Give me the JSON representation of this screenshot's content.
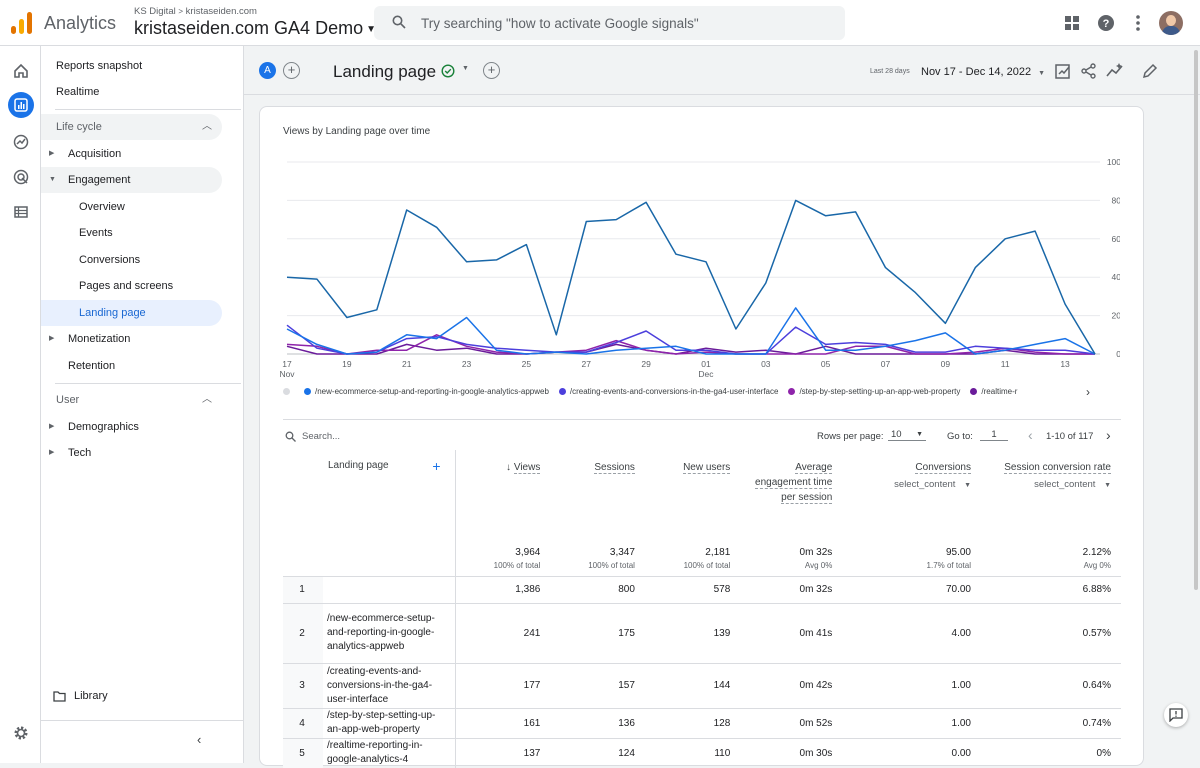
{
  "topbar": {
    "app_name": "Analytics",
    "account_sub_org": "KS Digital",
    "account_sub_prop": "kristaseiden.com",
    "property_name": "kristaseiden.com GA4 Demo",
    "search_placeholder": "Try searching \"how to activate Google signals\""
  },
  "sidebar": {
    "reports_snapshot": "Reports snapshot",
    "realtime": "Realtime",
    "lifecycle_label": "Life cycle",
    "acquisition": "Acquisition",
    "engagement": "Engagement",
    "engagement_items": [
      "Overview",
      "Events",
      "Conversions",
      "Pages and screens",
      "Landing page"
    ],
    "monetization": "Monetization",
    "retention": "Retention",
    "user_label": "User",
    "demographics": "Demographics",
    "tech": "Tech",
    "library": "Library"
  },
  "header": {
    "comparison_badge": "A",
    "page_title": "Landing page",
    "date_label": "Last 28 days",
    "date_range": "Nov 17 - Dec 14, 2022"
  },
  "chart_card": {
    "title": "Views by Landing page over time",
    "legend": [
      "/new-ecommerce-setup-and-reporting-in-google-analytics-appweb",
      "/creating-events-and-conversions-in-the-ga4-user-interface",
      "/step-by-step-setting-up-an-app-web-property",
      "/realtime-r"
    ],
    "series_colors": [
      "#dadce0",
      "#1a73e8",
      "#4c3fdc",
      "#8e24aa",
      "#6a1b9a"
    ]
  },
  "chart_data": {
    "type": "line",
    "x": [
      "17 Nov",
      "18",
      "19",
      "20",
      "21",
      "22",
      "23",
      "24",
      "25",
      "26",
      "27",
      "28",
      "29",
      "30",
      "01 Dec",
      "02",
      "03",
      "04",
      "05",
      "06",
      "07",
      "08",
      "09",
      "10",
      "11",
      "12",
      "13",
      "14"
    ],
    "x_tick_labels": [
      "17",
      "19",
      "21",
      "23",
      "25",
      "27",
      "29",
      "01",
      "03",
      "05",
      "07",
      "09",
      "11",
      "13"
    ],
    "x_tick_sublabels": {
      "17": "Nov",
      "01": "Dec"
    },
    "y_ticks": [
      0,
      20,
      40,
      60,
      80,
      100
    ],
    "ylim": [
      0,
      100
    ],
    "series": [
      {
        "values": [
          40,
          39,
          19,
          23,
          75,
          66,
          48,
          49,
          57,
          10,
          69,
          70,
          79,
          52,
          48,
          13,
          37,
          80,
          72,
          74,
          45,
          32,
          16,
          45,
          60,
          64,
          26,
          0
        ]
      },
      {
        "values": [
          13,
          5,
          0,
          1,
          10,
          8,
          19,
          2,
          0,
          1,
          0,
          2,
          3,
          4,
          0,
          0,
          0,
          24,
          2,
          2,
          4,
          7,
          11,
          0,
          2,
          5,
          8,
          0
        ]
      },
      {
        "values": [
          15,
          3,
          0,
          1,
          8,
          9,
          5,
          3,
          2,
          1,
          1,
          6,
          12,
          2,
          2,
          0,
          0,
          14,
          5,
          6,
          5,
          1,
          1,
          4,
          3,
          2,
          2,
          0
        ]
      },
      {
        "values": [
          5,
          4,
          0,
          2,
          2,
          10,
          4,
          1,
          0,
          1,
          2,
          7,
          2,
          0,
          1,
          0,
          0,
          0,
          0,
          4,
          4,
          0,
          0,
          1,
          3,
          1,
          0,
          0
        ]
      },
      {
        "values": [
          4,
          0,
          0,
          0,
          5,
          2,
          3,
          0,
          0,
          1,
          1,
          5,
          2,
          0,
          3,
          1,
          2,
          0,
          4,
          0,
          0,
          0,
          0,
          0,
          2,
          0,
          0,
          0
        ]
      }
    ]
  },
  "table_bar": {
    "search_placeholder": "Search...",
    "rows_per_page_label": "Rows per page:",
    "rows_per_page": "10",
    "goto_label": "Go to:",
    "goto_value": "1",
    "pagination": "1-10 of 117"
  },
  "table": {
    "headers": {
      "landing_page": "Landing page",
      "views": "Views",
      "sessions": "Sessions",
      "new_users": "New users",
      "avg_engagement": "Average engagement time per session",
      "conversions": "Conversions",
      "conversions_sub": "select_content",
      "session_conv": "Session conversion rate",
      "session_conv_sub": "select_content"
    },
    "totals": {
      "views": "3,964",
      "views_sub": "100% of total",
      "sessions": "3,347",
      "sessions_sub": "100% of total",
      "new_users": "2,181",
      "new_users_sub": "100% of total",
      "avg": "0m 32s",
      "avg_sub": "Avg 0%",
      "conv": "95.00",
      "conv_sub": "1.7% of total",
      "rate": "2.12%",
      "rate_sub": "Avg 0%"
    },
    "rows": [
      {
        "idx": "1",
        "page": "",
        "views": "1,386",
        "sessions": "800",
        "new_users": "578",
        "avg": "0m 32s",
        "conv": "70.00",
        "rate": "6.88%"
      },
      {
        "idx": "2",
        "page": "/new-ecommerce-setup-and-reporting-in-google-analytics-appweb",
        "views": "241",
        "sessions": "175",
        "new_users": "139",
        "avg": "0m 41s",
        "conv": "4.00",
        "rate": "0.57%"
      },
      {
        "idx": "3",
        "page": "/creating-events-and-conversions-in-the-ga4-user-interface",
        "views": "177",
        "sessions": "157",
        "new_users": "144",
        "avg": "0m 42s",
        "conv": "1.00",
        "rate": "0.64%"
      },
      {
        "idx": "4",
        "page": "/step-by-step-setting-up-an-app-web-property",
        "views": "161",
        "sessions": "136",
        "new_users": "128",
        "avg": "0m 52s",
        "conv": "1.00",
        "rate": "0.74%"
      },
      {
        "idx": "5",
        "page": "/realtime-reporting-in-google-analytics-4",
        "views": "137",
        "sessions": "124",
        "new_users": "110",
        "avg": "0m 30s",
        "conv": "0.00",
        "rate": "0%"
      }
    ]
  }
}
